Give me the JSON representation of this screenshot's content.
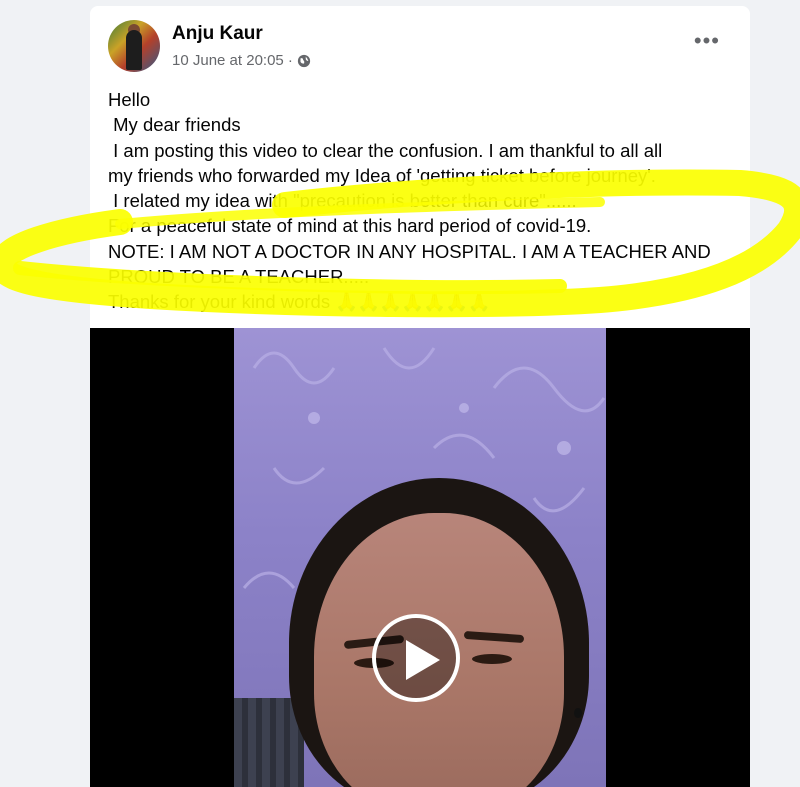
{
  "post": {
    "author": "Anju Kaur",
    "timestamp": "10 June at 20:05 ·",
    "audience_icon": "globe-icon",
    "more_icon": "•••",
    "lines": [
      "Hello",
      " My dear friends",
      " I am posting this video to clear the confusion. I am thankful to all all",
      "my friends who forwarded my Idea of 'getting ticket before journey'.",
      " I related my idea with \"precaution is better than cure\"......",
      "For a peaceful state of mind at this hard period of covid-19.",
      "NOTE: I AM NOT A DOCTOR IN ANY HOSPITAL. I AM A TEACHER AND",
      "PROUD TO BE A TEACHER.....",
      "Thanks for your kind words "
    ],
    "emoji": "🙏🙏🙏🙏🙏🙏🙏"
  },
  "colors": {
    "highlight": "#fbff00",
    "text": "#050505",
    "meta": "#65676b"
  },
  "video": {
    "play_icon": "play-icon"
  }
}
